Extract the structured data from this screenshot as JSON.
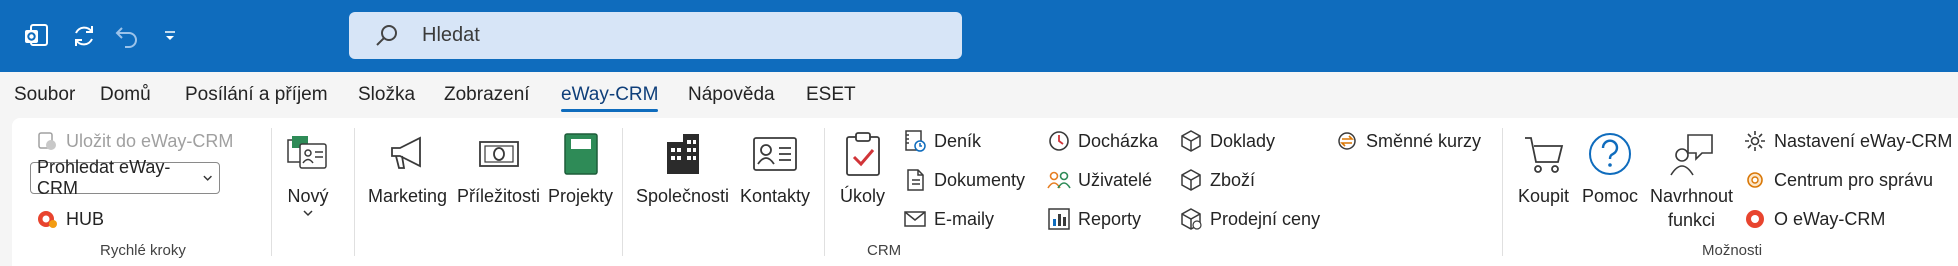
{
  "search": {
    "placeholder": "Hledat"
  },
  "menu": [
    "Soubor",
    "Domů",
    "Posílání a příjem",
    "Složka",
    "Zobrazení",
    "eWay-CRM",
    "Nápověda",
    "ESET"
  ],
  "ribbon": {
    "quick": {
      "save": "Uložit do eWay-CRM",
      "search_select": "Prohledat eWay-CRM",
      "hub": "HUB",
      "label": "Rychlé kroky"
    },
    "crm": {
      "new": "Nový",
      "marketing": "Marketing",
      "opportunities": "Příležitosti",
      "projects": "Projekty",
      "companies": "Společnosti",
      "contacts": "Kontakty",
      "tasks": "Úkoly",
      "journal": "Deník",
      "documents": "Dokumenty",
      "emails": "E-maily",
      "attendance": "Docházka",
      "users": "Uživatelé",
      "reports": "Reporty",
      "docs": "Doklady",
      "goods": "Zboží",
      "prices": "Prodejní ceny",
      "exchange": "Směnné kurzy",
      "label": "CRM"
    },
    "options": {
      "buy": "Koupit",
      "help": "Pomoc",
      "suggest_1": "Navrhnout",
      "suggest_2": "funkci",
      "settings": "Nastavení eWay-CRM",
      "admin": "Centrum pro správu",
      "about": "O eWay-CRM",
      "label": "Možnosti"
    }
  }
}
